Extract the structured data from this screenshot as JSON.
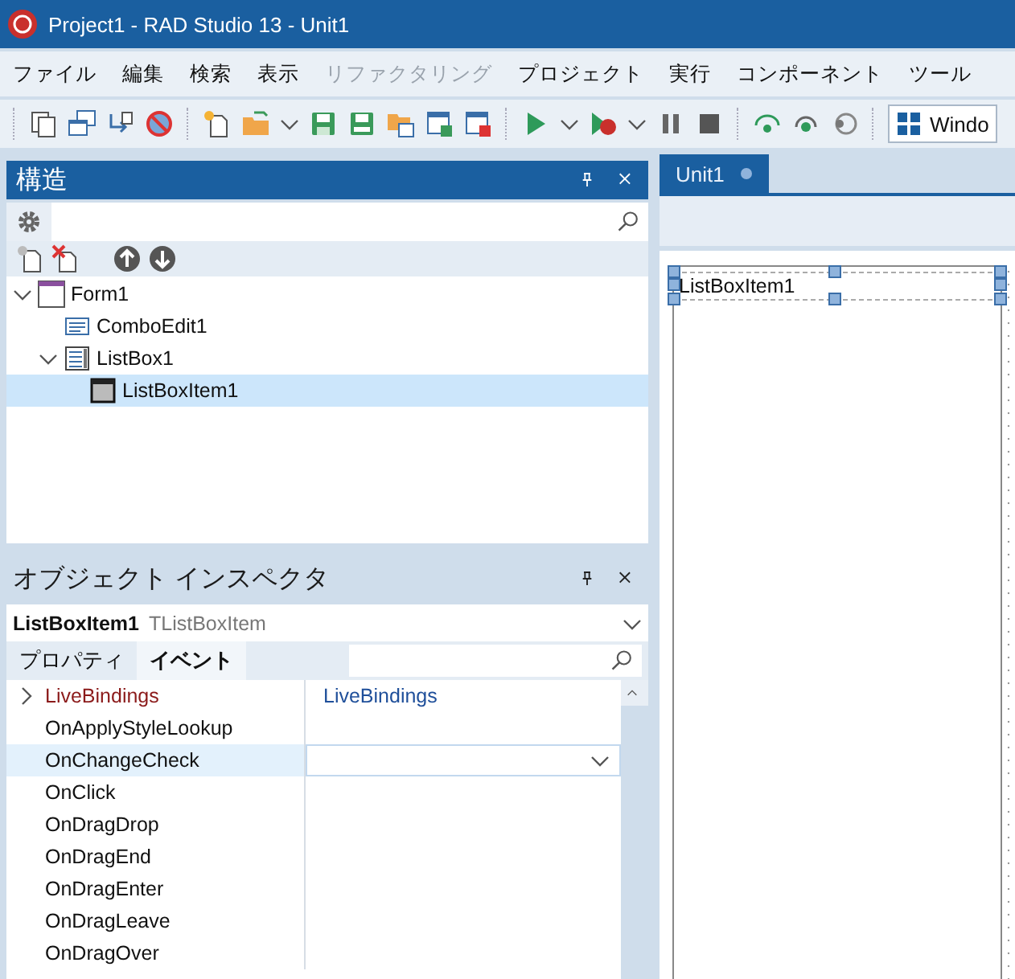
{
  "window": {
    "title": "Project1 - RAD Studio 13 - Unit1"
  },
  "menu": [
    {
      "label": "ファイル",
      "disabled": false
    },
    {
      "label": "編集",
      "disabled": false
    },
    {
      "label": "検索",
      "disabled": false
    },
    {
      "label": "表示",
      "disabled": false
    },
    {
      "label": "リファクタリング",
      "disabled": true
    },
    {
      "label": "プロジェクト",
      "disabled": false
    },
    {
      "label": "実行",
      "disabled": false
    },
    {
      "label": "コンポーネント",
      "disabled": false
    },
    {
      "label": "ツール",
      "disabled": false
    }
  ],
  "toolbar": {
    "platform_selector": "Windo"
  },
  "structure": {
    "title": "構造",
    "tree": [
      {
        "label": "Form1",
        "kind": "form",
        "expanded": true,
        "selected": false,
        "children": [
          {
            "label": "ComboEdit1",
            "kind": "edit",
            "selected": false
          },
          {
            "label": "ListBox1",
            "kind": "listbox",
            "expanded": true,
            "selected": false,
            "children": [
              {
                "label": "ListBoxItem1",
                "kind": "item",
                "selected": true
              }
            ]
          }
        ]
      }
    ]
  },
  "inspector": {
    "title": "オブジェクト インスペクタ",
    "object_name": "ListBoxItem1",
    "object_type": "TListBoxItem",
    "tabs": [
      {
        "label": "プロパティ",
        "selected": false
      },
      {
        "label": "イベント",
        "selected": true
      }
    ],
    "rows": [
      {
        "name": "LiveBindings",
        "value": "LiveBindings",
        "kind": "group",
        "selected": false
      },
      {
        "name": "OnApplyStyleLookup",
        "kind": "event",
        "selected": false
      },
      {
        "name": "OnChangeCheck",
        "kind": "event",
        "selected": true
      },
      {
        "name": "OnClick",
        "kind": "event",
        "selected": false
      },
      {
        "name": "OnDragDrop",
        "kind": "event",
        "selected": false
      },
      {
        "name": "OnDragEnd",
        "kind": "event",
        "selected": false
      },
      {
        "name": "OnDragEnter",
        "kind": "event",
        "selected": false
      },
      {
        "name": "OnDragLeave",
        "kind": "event",
        "selected": false
      },
      {
        "name": "OnDragOver",
        "kind": "event",
        "selected": false
      }
    ]
  },
  "designer": {
    "tabs": [
      {
        "label": "Unit1",
        "selected": true
      }
    ],
    "list_item": "ListBoxItem1"
  }
}
